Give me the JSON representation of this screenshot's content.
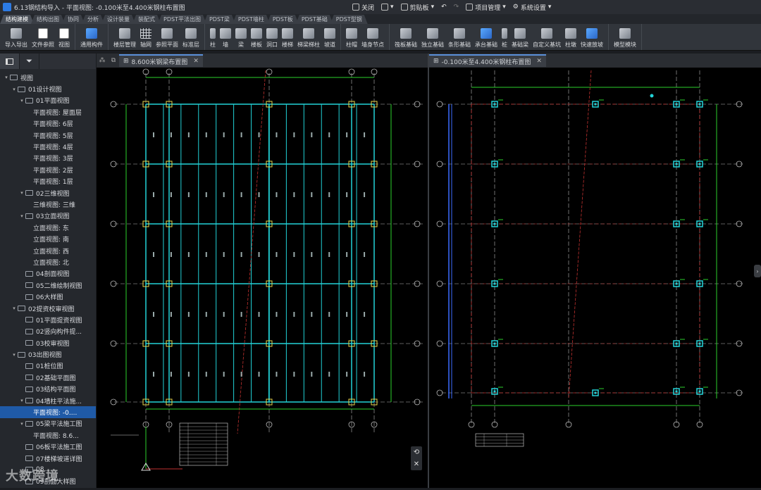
{
  "app": {
    "title": "6.13钢结构导入 - 平面视图: -0.100米至4.400米钢柱布置图",
    "quick": [
      "关闭",
      "剪贴板",
      "项目管理",
      "系统设置"
    ]
  },
  "tabs": [
    "结构建模",
    "结构出图",
    "协同",
    "分析",
    "设计装量",
    "装配式",
    "PDST平法出图",
    "PDST梁",
    "PDST墙柱",
    "PDST板",
    "PDST基础",
    "PDST型钢"
  ],
  "ribbon": [
    {
      "items": [
        {
          "label": "导入导出",
          "icon": "cad-import-icon"
        },
        {
          "label": "文件参照",
          "icon": "file-reference-icon"
        },
        {
          "label": "视图",
          "icon": "view-icon"
        }
      ]
    },
    {
      "items": [
        {
          "label": "通用构件",
          "icon": "generic-component-icon"
        }
      ]
    },
    {
      "items": [
        {
          "label": "楼层管理",
          "icon": "floor-manage-icon"
        },
        {
          "label": "轴网",
          "icon": "axis-grid-icon"
        },
        {
          "label": "参照平面",
          "icon": "ref-plane-icon"
        },
        {
          "label": "标准层",
          "icon": "standard-floor-icon"
        }
      ]
    },
    {
      "items": [
        {
          "label": "柱",
          "icon": "column-icon"
        },
        {
          "label": "墙",
          "icon": "wall-icon"
        },
        {
          "label": "梁",
          "icon": "beam-icon"
        },
        {
          "label": "楼板",
          "icon": "slab-icon"
        },
        {
          "label": "洞口",
          "icon": "opening-icon"
        },
        {
          "label": "楼梯",
          "icon": "stair-icon"
        },
        {
          "label": "梯梁梯柱",
          "icon": "stair-beam-icon"
        },
        {
          "label": "坡道",
          "icon": "ramp-icon"
        }
      ]
    },
    {
      "items": [
        {
          "label": "柱帽",
          "icon": "column-cap-icon"
        },
        {
          "label": "墙身节点",
          "icon": "wall-node-icon"
        }
      ]
    },
    {
      "items": [
        {
          "label": "筏板基础",
          "icon": "raft-foundation-icon"
        },
        {
          "label": "独立基础",
          "icon": "isolated-foundation-icon"
        },
        {
          "label": "条形基础",
          "icon": "strip-foundation-icon"
        },
        {
          "label": "承台基础",
          "icon": "pile-cap-icon"
        },
        {
          "label": "桩",
          "icon": "pile-icon"
        },
        {
          "label": "基础梁",
          "icon": "foundation-beam-icon"
        },
        {
          "label": "自定义基坑",
          "icon": "custom-pit-icon"
        },
        {
          "label": "柱墩",
          "icon": "pier-icon"
        },
        {
          "label": "快速放坡",
          "icon": "quick-slope-icon"
        }
      ]
    },
    {
      "items": [
        {
          "label": "模型模块",
          "icon": "model-module-icon"
        }
      ]
    }
  ],
  "tree": [
    {
      "t": "视图",
      "lv": 0,
      "exp": "v",
      "f": true
    },
    {
      "t": "01设计视图",
      "lv": 1,
      "exp": "v",
      "f": true
    },
    {
      "t": "01平面视图",
      "lv": 2,
      "exp": "v",
      "f": true
    },
    {
      "t": "平面视图: 屋面层",
      "lv": 3
    },
    {
      "t": "平面视图: 6层",
      "lv": 3
    },
    {
      "t": "平面视图: 5层",
      "lv": 3
    },
    {
      "t": "平面视图: 4层",
      "lv": 3
    },
    {
      "t": "平面视图: 3层",
      "lv": 3
    },
    {
      "t": "平面视图: 2层",
      "lv": 3
    },
    {
      "t": "平面视图: 1层",
      "lv": 3
    },
    {
      "t": "02三维视图",
      "lv": 2,
      "exp": "v",
      "f": true
    },
    {
      "t": "三维视图: 三维",
      "lv": 3
    },
    {
      "t": "03立面视图",
      "lv": 2,
      "exp": "v",
      "f": true
    },
    {
      "t": "立面视图: 东",
      "lv": 3
    },
    {
      "t": "立面视图: 南",
      "lv": 3
    },
    {
      "t": "立面视图: 西",
      "lv": 3
    },
    {
      "t": "立面视图: 北",
      "lv": 3
    },
    {
      "t": "04剖面视图",
      "lv": 2,
      "f": true
    },
    {
      "t": "05二维绘制视图",
      "lv": 2,
      "f": true
    },
    {
      "t": "06大样图",
      "lv": 2,
      "f": true
    },
    {
      "t": "02提资校审视图",
      "lv": 1,
      "exp": "v",
      "f": true
    },
    {
      "t": "01平面提资视图",
      "lv": 2,
      "f": true
    },
    {
      "t": "02竖向构件提...",
      "lv": 2,
      "f": true
    },
    {
      "t": "03校审视图",
      "lv": 2,
      "f": true
    },
    {
      "t": "03出图视图",
      "lv": 1,
      "exp": "v",
      "f": true
    },
    {
      "t": "01桩位图",
      "lv": 2,
      "f": true
    },
    {
      "t": "02基础平面图",
      "lv": 2,
      "f": true
    },
    {
      "t": "03结构平面图",
      "lv": 2,
      "f": true
    },
    {
      "t": "04墙柱平法施...",
      "lv": 2,
      "exp": "v",
      "f": true
    },
    {
      "t": "平面视图: -0....",
      "lv": 3,
      "sel": true
    },
    {
      "t": "05梁平法施工图",
      "lv": 2,
      "exp": "v",
      "f": true
    },
    {
      "t": "平面视图: 8.6...",
      "lv": 3
    },
    {
      "t": "06板平法施工图",
      "lv": 2,
      "f": true
    },
    {
      "t": "07楼梯坡道详图",
      "lv": 2,
      "f": true
    },
    {
      "t": "08...",
      "lv": 2,
      "f": true
    },
    {
      "t": "09剖面大样图",
      "lv": 2,
      "f": true
    }
  ],
  "views": {
    "left": {
      "tab": "8.600米钢梁布置图"
    },
    "right": {
      "tab": "-0.100米至4.400米钢柱布置图"
    }
  },
  "watermark": "大数跨境",
  "colors": {
    "accent": "#1f5aa7",
    "cyan": "#22d3d8",
    "green": "#2bd12b",
    "red": "#c0312f",
    "yellow": "#e8d44a",
    "grid": "#b8b8b8"
  }
}
